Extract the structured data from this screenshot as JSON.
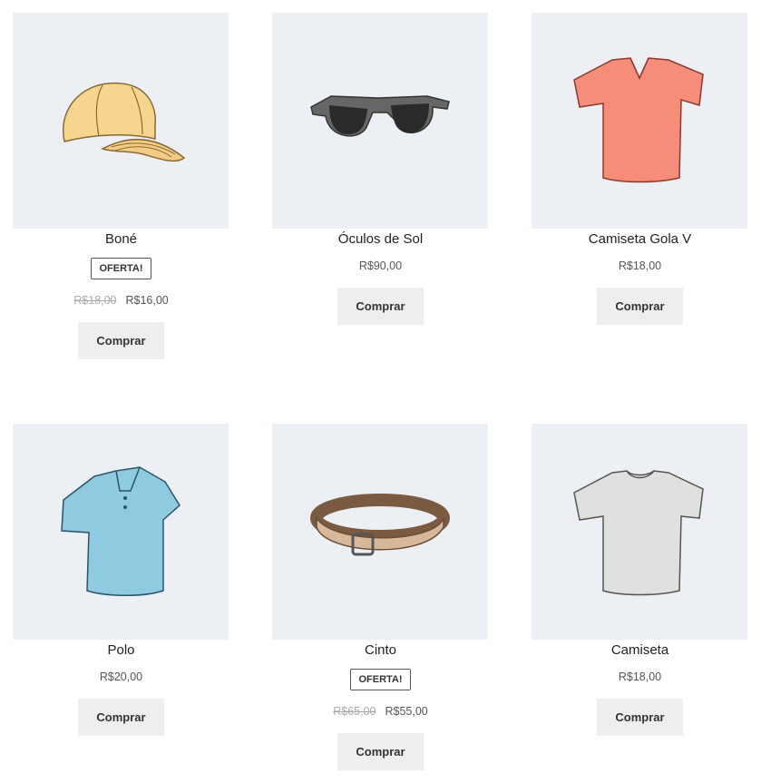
{
  "products": [
    {
      "name": "Boné",
      "badge": "OFERTA!",
      "old_price": "R$18,00",
      "price": "R$16,00",
      "button": "Comprar"
    },
    {
      "name": "Óculos de Sol",
      "price": "R$90,00",
      "button": "Comprar"
    },
    {
      "name": "Camiseta Gola V",
      "price": "R$18,00",
      "button": "Comprar"
    },
    {
      "name": "Polo",
      "price": "R$20,00",
      "button": "Comprar"
    },
    {
      "name": "Cinto",
      "badge": "OFERTA!",
      "old_price": "R$65,00",
      "price": "R$55,00",
      "button": "Comprar"
    },
    {
      "name": "Camiseta",
      "price": "R$18,00",
      "button": "Comprar"
    }
  ]
}
